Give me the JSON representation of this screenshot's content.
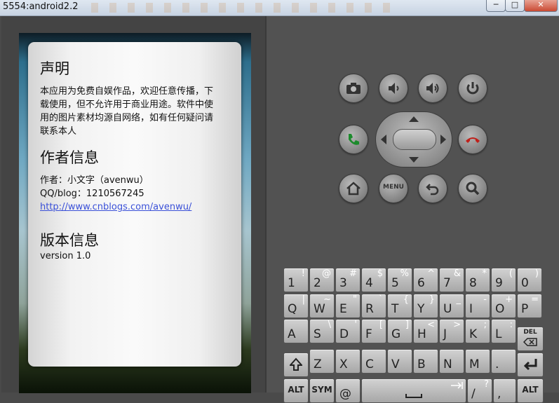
{
  "window": {
    "title": "5554:android2.2",
    "min": "─",
    "max": "□",
    "close": "✕"
  },
  "app": {
    "s1_title": "声明",
    "s1_line1": "本应用为免费自娱作品，欢迎任意传播，下",
    "s1_line2": "载使用，但不允许用于商业用途。软件中使",
    "s1_line3": "用的图片素材均源自网络，如有任何疑问请",
    "s1_line4": "联系本人",
    "s2_title": "作者信息",
    "author": "作者：小文字（avenwu）",
    "qq": "QQ/blog：1210567245",
    "link": "http://www.cnblogs.com/avenwu/",
    "s3_title": "版本信息",
    "version": "version 1.0"
  },
  "controls": [
    "camera-icon",
    "volume-down-icon",
    "volume-up-icon",
    "power-icon",
    "call-icon",
    "end-call-icon",
    "home-icon",
    "menu-icon",
    "back-icon",
    "search-icon"
  ],
  "menu_label": "MENU",
  "keyboard": {
    "row1": [
      [
        "1",
        "!"
      ],
      [
        "2",
        "@"
      ],
      [
        "3",
        "#"
      ],
      [
        "4",
        "$"
      ],
      [
        "5",
        "%"
      ],
      [
        "6",
        "^"
      ],
      [
        "7",
        "&"
      ],
      [
        "8",
        "*"
      ],
      [
        "9",
        "("
      ],
      [
        "0",
        ")"
      ]
    ],
    "row2": [
      [
        "Q",
        "|"
      ],
      [
        "W",
        "~"
      ],
      [
        "E",
        "\""
      ],
      [
        "R",
        "`"
      ],
      [
        "T",
        "{"
      ],
      [
        "Y",
        "}"
      ],
      [
        "U",
        "_"
      ],
      [
        "I",
        "-"
      ],
      [
        "O",
        "+"
      ],
      [
        "P",
        "="
      ]
    ],
    "row3": [
      [
        "A",
        ""
      ],
      [
        "S",
        "\\"
      ],
      [
        "D",
        "'"
      ],
      [
        "F",
        "["
      ],
      [
        "G",
        "]"
      ],
      [
        "H",
        "<"
      ],
      [
        "J",
        ">"
      ],
      [
        "K",
        ";"
      ],
      [
        "L",
        ":"
      ]
    ],
    "row4": [
      [
        "Z",
        ""
      ],
      [
        "X",
        ""
      ],
      [
        "C",
        ""
      ],
      [
        "V",
        ""
      ],
      [
        "B",
        ""
      ],
      [
        "N",
        ""
      ],
      [
        "M",
        ""
      ],
      [
        ".",
        ""
      ]
    ],
    "del": "DEL",
    "alt": "ALT",
    "sym": "SYM",
    "at": "@",
    "slash": "/",
    "question": "?",
    "comma": ","
  }
}
